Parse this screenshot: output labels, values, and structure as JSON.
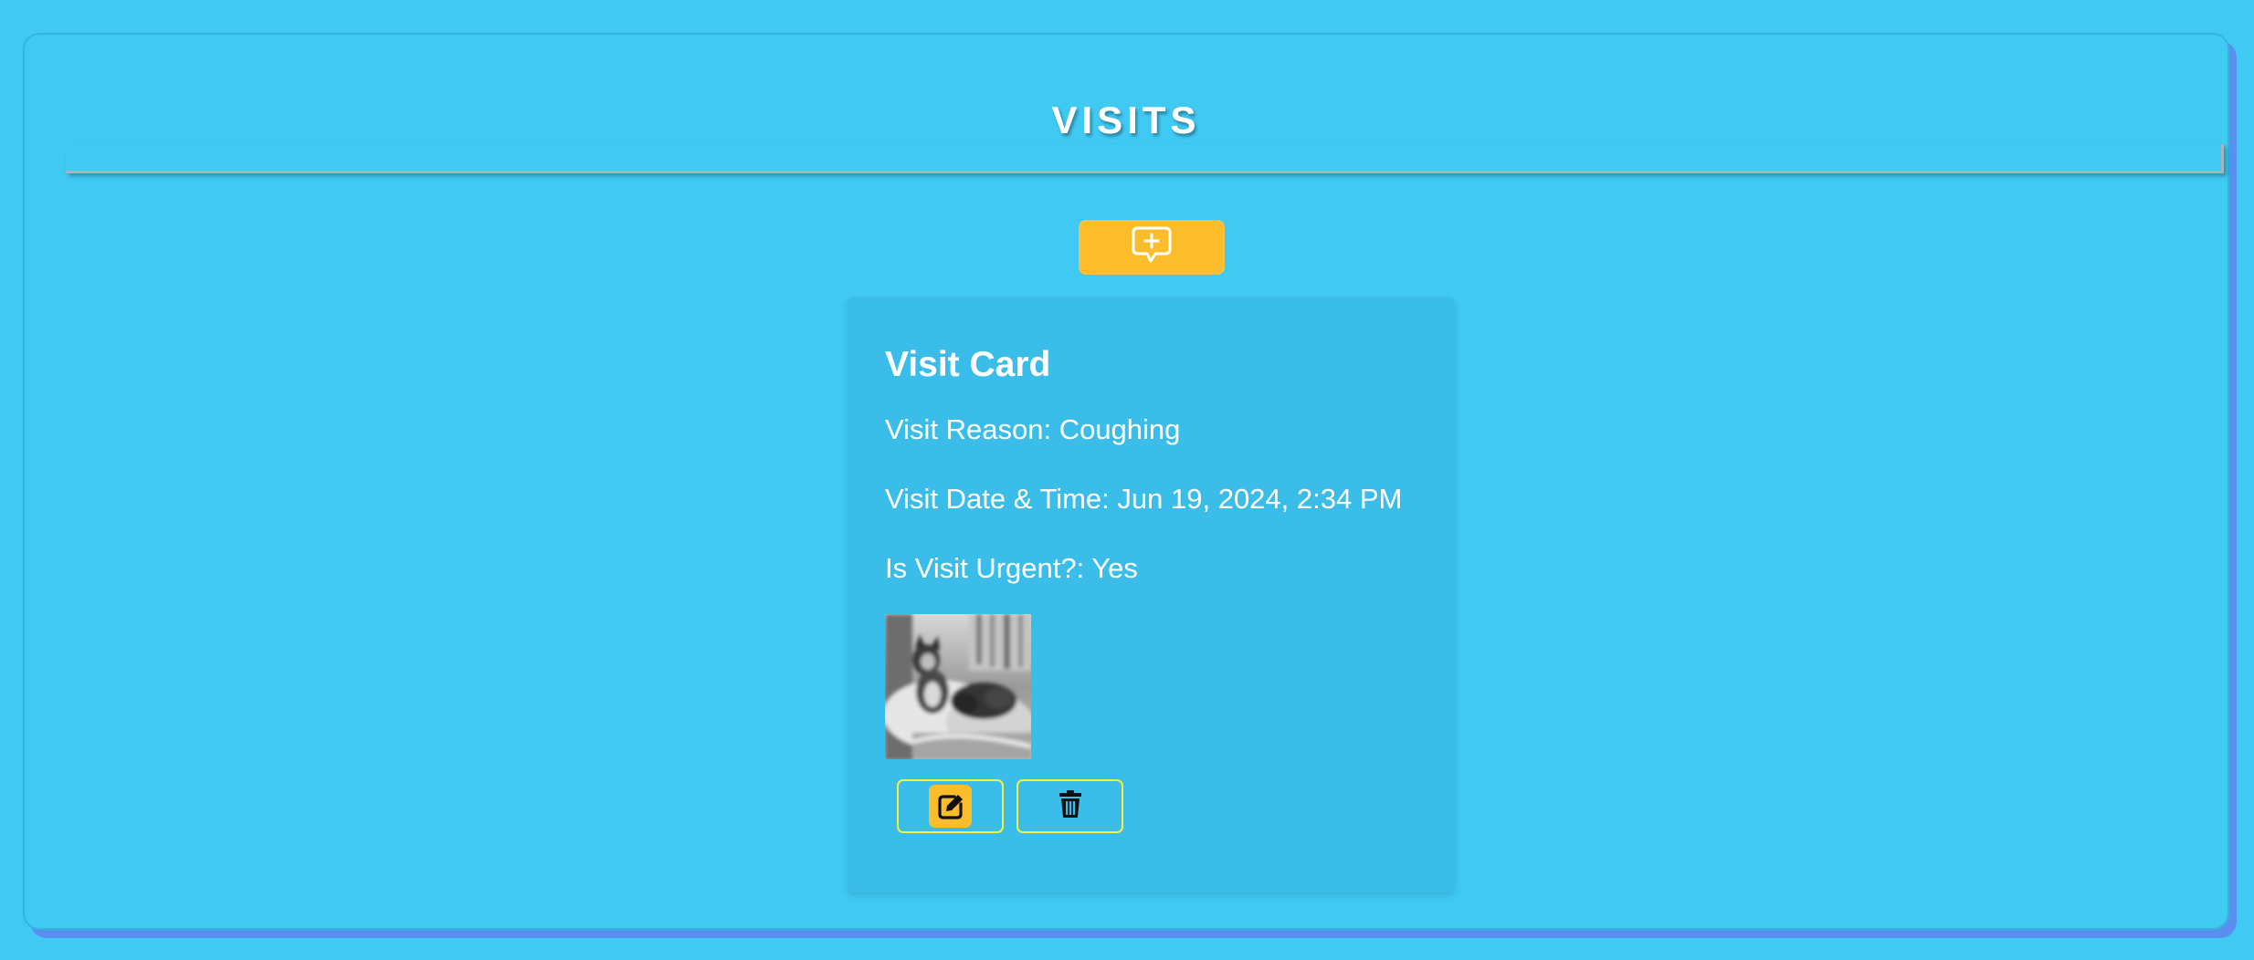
{
  "page": {
    "title": "VISITS"
  },
  "toolbar": {
    "add_icon": "add-comment-icon"
  },
  "visit_card": {
    "title": "Visit Card",
    "reason": "Visit Reason: Coughing",
    "datetime": "Visit Date & Time: Jun 19, 2024, 2:34 PM",
    "urgent": "Is Visit Urgent?: Yes",
    "photo_icon": "pet-photo",
    "edit_icon": "edit-icon",
    "delete_icon": "trash-icon"
  },
  "colors": {
    "background": "#40c9f3",
    "card": "#3bbde9",
    "accent": "#fbbd2c",
    "button_border": "#f6f33c",
    "panel_shadow": "#5a8ff0"
  }
}
